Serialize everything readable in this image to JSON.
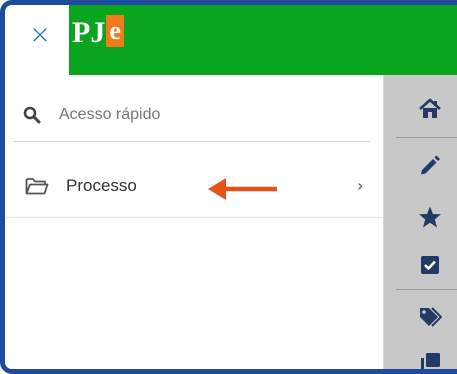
{
  "header": {
    "close_label": "×",
    "logo_text": "PJ",
    "logo_badge": "e",
    "bar_color": "#0aa51e",
    "badge_color": "#f07b1a"
  },
  "search": {
    "placeholder": "Acesso rápido",
    "value": ""
  },
  "menu": {
    "items": [
      {
        "label": "Processo",
        "icon": "folder-icon",
        "chevron": "›"
      }
    ]
  },
  "annotation": {
    "arrow_color": "#e2541b",
    "direction": "left"
  },
  "rail": {
    "icons": [
      "home-icon",
      "pencil-icon",
      "star-icon",
      "checkbox-icon",
      "tags-icon",
      "clone-icon"
    ]
  }
}
